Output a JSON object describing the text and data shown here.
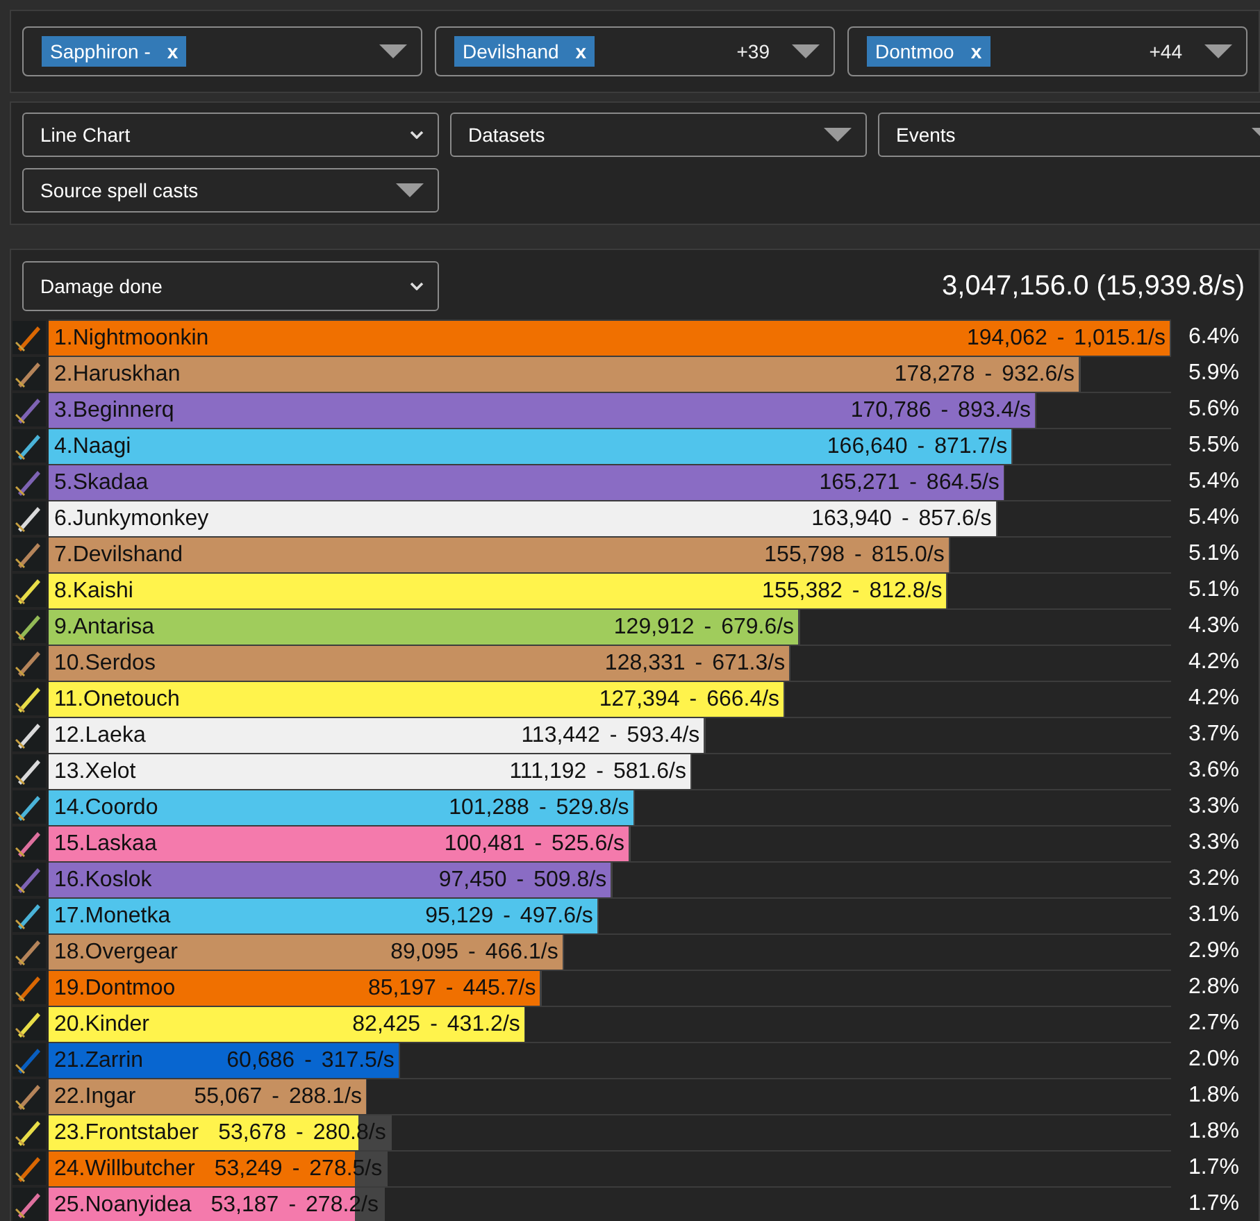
{
  "filters": [
    {
      "tag": "Sapphiron -",
      "remove": "x"
    },
    {
      "tag": "Devilshand",
      "remove": "x",
      "count": "+39"
    },
    {
      "tag": "Dontmoo",
      "remove": "x",
      "count": "+44"
    }
  ],
  "options": [
    {
      "kind": "select",
      "label": "Line Chart"
    },
    {
      "kind": "dropdown",
      "label": "Datasets"
    },
    {
      "kind": "dropdown",
      "label": "Events"
    },
    {
      "kind": "dropdown",
      "label": "Source spell casts"
    }
  ],
  "meter": {
    "metric": "Damage done",
    "total": "3,047,156.0 (15,939.8/s)",
    "rows": [
      {
        "name": "1.Nightmoonkin",
        "amount": "194,062",
        "sep": "-",
        "rate": "1,015.1/s",
        "percent": "6.4%",
        "level": 1.0,
        "color": "#f07000"
      },
      {
        "name": "2.Haruskhan",
        "amount": "178,278",
        "sep": "-",
        "rate": "932.6/s",
        "percent": "5.9%",
        "level": 0.919,
        "color": "#c69060"
      },
      {
        "name": "3.Beginnerq",
        "amount": "170,786",
        "sep": "-",
        "rate": "893.4/s",
        "percent": "5.6%",
        "level": 0.88,
        "color": "#8a6cc4"
      },
      {
        "name": "4.Naagi",
        "amount": "166,640",
        "sep": "-",
        "rate": "871.7/s",
        "percent": "5.5%",
        "level": 0.859,
        "color": "#50c4ec"
      },
      {
        "name": "5.Skadaa",
        "amount": "165,271",
        "sep": "-",
        "rate": "864.5/s",
        "percent": "5.4%",
        "level": 0.852,
        "color": "#8a6cc4"
      },
      {
        "name": "6.Junkymonkey",
        "amount": "163,940",
        "sep": "-",
        "rate": "857.6/s",
        "percent": "5.4%",
        "level": 0.845,
        "color": "#f0f0f0"
      },
      {
        "name": "7.Devilshand",
        "amount": "155,798",
        "sep": "-",
        "rate": "815.0/s",
        "percent": "5.1%",
        "level": 0.803,
        "color": "#c69060"
      },
      {
        "name": "8.Kaishi",
        "amount": "155,382",
        "sep": "-",
        "rate": "812.8/s",
        "percent": "5.1%",
        "level": 0.801,
        "color": "#fff34c"
      },
      {
        "name": "9.Antarisa",
        "amount": "129,912",
        "sep": "-",
        "rate": "679.6/s",
        "percent": "4.3%",
        "level": 0.669,
        "color": "#a0cc5c"
      },
      {
        "name": "10.Serdos",
        "amount": "128,331",
        "sep": "-",
        "rate": "671.3/s",
        "percent": "4.2%",
        "level": 0.661,
        "color": "#c69060"
      },
      {
        "name": "11.Onetouch",
        "amount": "127,394",
        "sep": "-",
        "rate": "666.4/s",
        "percent": "4.2%",
        "level": 0.656,
        "color": "#fff34c"
      },
      {
        "name": "12.Laeka",
        "amount": "113,442",
        "sep": "-",
        "rate": "593.4/s",
        "percent": "3.7%",
        "level": 0.585,
        "color": "#f0f0f0"
      },
      {
        "name": "13.Xelot",
        "amount": "111,192",
        "sep": "-",
        "rate": "581.6/s",
        "percent": "3.6%",
        "level": 0.573,
        "color": "#f0f0f0"
      },
      {
        "name": "14.Coordo",
        "amount": "101,288",
        "sep": "-",
        "rate": "529.8/s",
        "percent": "3.3%",
        "level": 0.522,
        "color": "#50c4ec"
      },
      {
        "name": "15.Laskaa",
        "amount": "100,481",
        "sep": "-",
        "rate": "525.6/s",
        "percent": "3.3%",
        "level": 0.518,
        "color": "#f47aac"
      },
      {
        "name": "16.Koslok",
        "amount": "97,450",
        "sep": "-",
        "rate": "509.8/s",
        "percent": "3.2%",
        "level": 0.502,
        "color": "#8a6cc4"
      },
      {
        "name": "17.Monetka",
        "amount": "95,129",
        "sep": "-",
        "rate": "497.6/s",
        "percent": "3.1%",
        "level": 0.49,
        "color": "#50c4ec"
      },
      {
        "name": "18.Overgear",
        "amount": "89,095",
        "sep": "-",
        "rate": "466.1/s",
        "percent": "2.9%",
        "level": 0.459,
        "color": "#c69060"
      },
      {
        "name": "19.Dontmoo",
        "amount": "85,197",
        "sep": "-",
        "rate": "445.7/s",
        "percent": "2.8%",
        "level": 0.439,
        "color": "#f07000"
      },
      {
        "name": "20.Kinder",
        "amount": "82,425",
        "sep": "-",
        "rate": "431.2/s",
        "percent": "2.7%",
        "level": 0.425,
        "color": "#fff34c"
      },
      {
        "name": "21.Zarrin",
        "amount": "60,686",
        "sep": "-",
        "rate": "317.5/s",
        "percent": "2.0%",
        "level": 0.313,
        "color": "#0866d0"
      },
      {
        "name": "22.Ingar",
        "amount": "55,067",
        "sep": "-",
        "rate": "288.1/s",
        "percent": "1.8%",
        "level": 0.284,
        "color": "#c69060"
      },
      {
        "name": "23.Frontstaber",
        "amount": "53,678",
        "sep": "-",
        "rate": "280.8/s",
        "percent": "1.8%",
        "level": 0.277,
        "color": "#fff34c"
      },
      {
        "name": "24.Willbutcher",
        "amount": "53,249",
        "sep": "-",
        "rate": "278.5/s",
        "percent": "1.7%",
        "level": 0.274,
        "color": "#f07000"
      },
      {
        "name": "25.Noanyidea",
        "amount": "53,187",
        "sep": "-",
        "rate": "278.2/s",
        "percent": "1.7%",
        "level": 0.274,
        "color": "#f47aac"
      }
    ]
  }
}
